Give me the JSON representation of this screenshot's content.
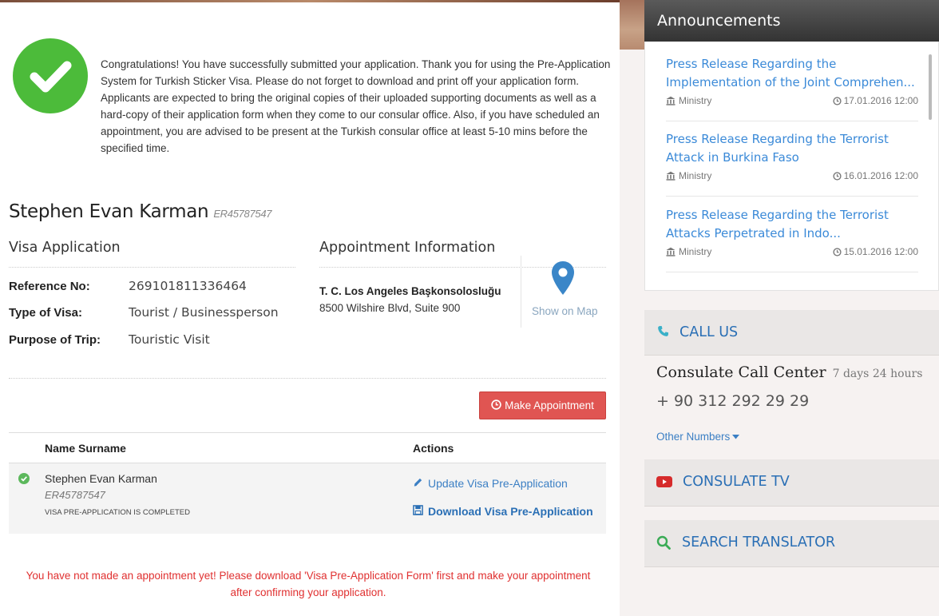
{
  "success": {
    "message": "Congratulations! You have successfully submitted your application. Thank you for using the Pre-Application System for Turkish Sticker Visa. Please do not forget to download and print off your application form. Applicants are expected to bring the original copies of their uploaded supporting documents as well as a hard-copy of their application form when they come to our consular office. Also, if you have scheduled an appointment, you are advised to be present at the Turkish consular office at least 5-10 mins before the specified time."
  },
  "applicant": {
    "name": "Stephen Evan Karman",
    "ref": "ER45787547"
  },
  "visa_application": {
    "title": "Visa Application",
    "fields": [
      {
        "label": "Reference No:",
        "value": "269101811336464"
      },
      {
        "label": "Type of Visa:",
        "value": "Tourist / Businessperson"
      },
      {
        "label": "Purpose of Trip:",
        "value": "Touristic Visit"
      }
    ]
  },
  "appointment": {
    "title": "Appointment Information",
    "consulate": "T. C. Los Angeles Başkonsolosluğu",
    "address": "8500 Wilshire Blvd, Suite 900",
    "map_label": "Show on Map",
    "make_button": "Make Appointment"
  },
  "table": {
    "headers": {
      "name": "Name Surname",
      "actions": "Actions"
    },
    "row": {
      "name": "Stephen Evan Karman",
      "ref": "ER45787547",
      "status": "VISA PRE-APPLICATION IS COMPLETED",
      "update": "Update Visa Pre-Application",
      "download": "Download Visa Pre-Application"
    }
  },
  "warning": "You have not made an appointment yet! Please download 'Visa Pre-Application Form' first and make your appointment after confirming your application.",
  "sidebar": {
    "announcements": {
      "title": "Announcements",
      "items": [
        {
          "title": "Press Release Regarding the Implementation of the Joint Comprehen...",
          "source": "Ministry",
          "date": "17.01.2016 12:00"
        },
        {
          "title": "Press Release Regarding the Terrorist Attack in Burkina Faso",
          "source": "Ministry",
          "date": "16.01.2016 12:00"
        },
        {
          "title": "Press Release Regarding the Terrorist Attacks Perpetrated in Indo...",
          "source": "Ministry",
          "date": "15.01.2016 12:00"
        }
      ]
    },
    "call_us": {
      "title": "CALL US",
      "center": "Consulate Call Center",
      "hours": "7 days 24 hours",
      "phone": "+ 90 312 292 29 29",
      "other": "Other Numbers"
    },
    "consulate_tv": "CONSULATE TV",
    "search_translator": "SEARCH TRANSLATOR"
  },
  "colors": {
    "success_green": "#4cbb3a",
    "link_blue": "#3b7fc4",
    "danger_red": "#e05552",
    "warning_text": "#e03030"
  },
  "icons": [
    "check-circle-icon",
    "map-marker-icon",
    "clock-icon",
    "edit-icon",
    "save-icon",
    "bank-icon",
    "phone-icon",
    "youtube-icon",
    "search-icon",
    "caret-down-icon"
  ]
}
